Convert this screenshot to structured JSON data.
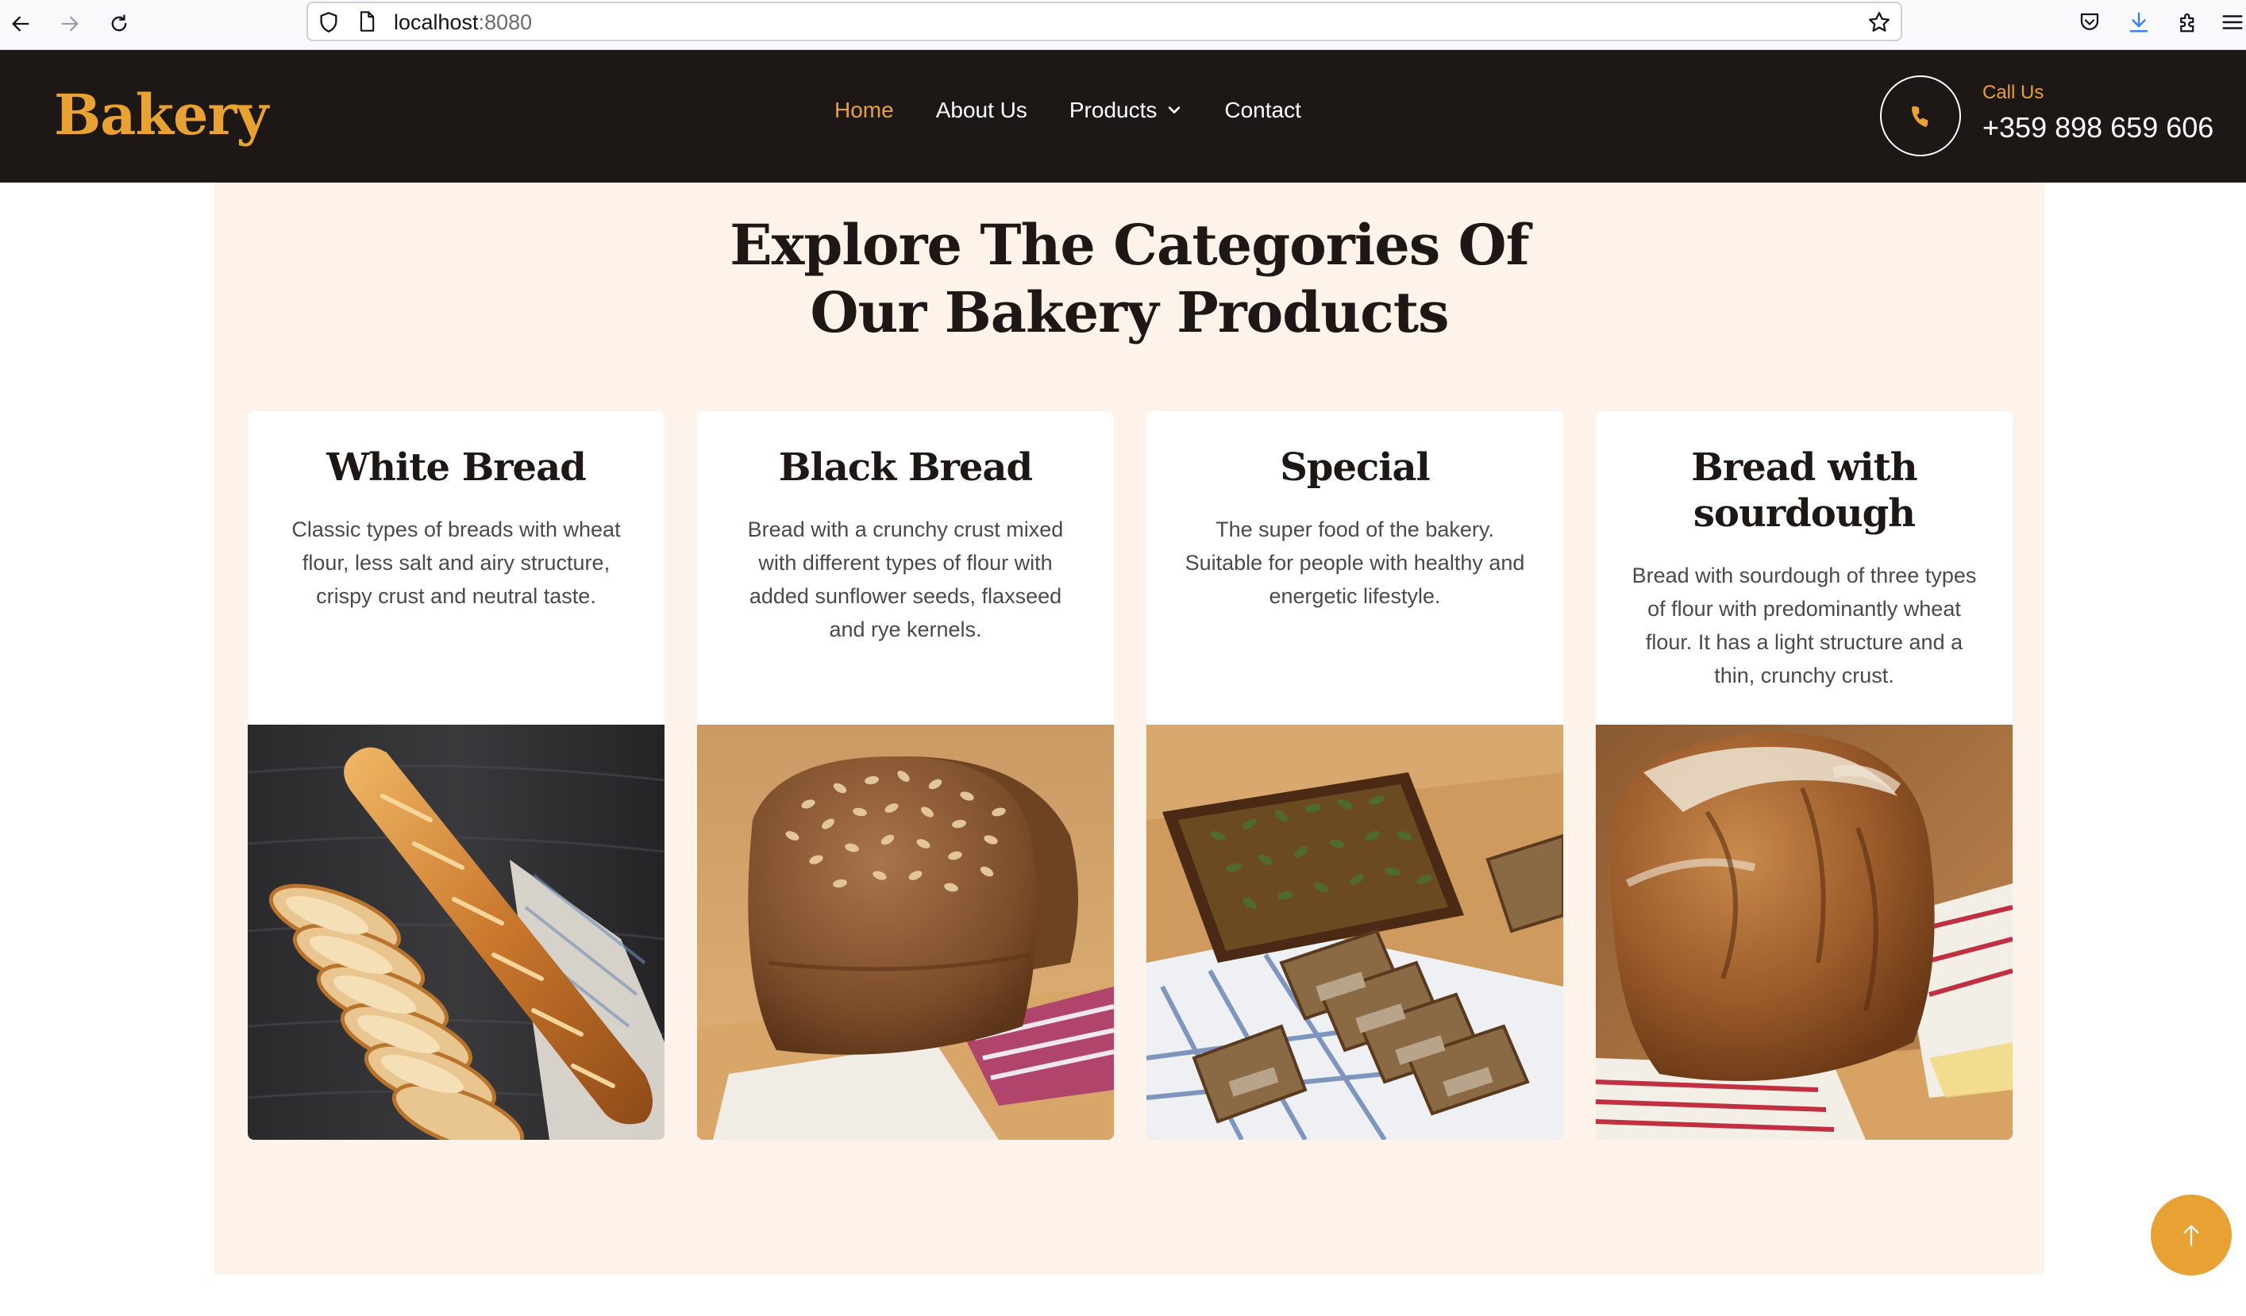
{
  "browser": {
    "url_host": "localhost",
    "url_port": ":8080"
  },
  "header": {
    "logo": "Bakery",
    "menu": [
      {
        "label": "Home",
        "active": true
      },
      {
        "label": "About Us",
        "active": false
      },
      {
        "label": "Products",
        "active": false,
        "has_dropdown": true
      },
      {
        "label": "Contact",
        "active": false
      }
    ],
    "call_label": "Call Us",
    "call_number": "+359 898 659 606"
  },
  "section": {
    "title_line1": "Explore The Categories Of",
    "title_line2": "Our Bakery Products",
    "cards": [
      {
        "title": "White Bread",
        "description": "Classic types of breads with wheat flour, less salt and airy structure, crispy crust and neutral taste.",
        "image": "baguette-photo"
      },
      {
        "title": "Black Bread",
        "description": "Bread with a crunchy crust mixed with different types of flour with added sunflower seeds, flaxseed and rye kernels.",
        "image": "seeded-loaf-photo"
      },
      {
        "title": "Special",
        "description": "The super food of the bakery. Suitable for people with healthy and energetic lifestyle.",
        "image": "pumpkin-seed-loaf-photo"
      },
      {
        "title": "Bread with sourdough",
        "description": "Bread with sourdough of three types of flour with predominantly wheat flour. It has a light structure and a thin, crunchy crust.",
        "image": "sourdough-loaf-photo"
      }
    ]
  },
  "colors": {
    "accent": "#e8a234",
    "header_bg": "#1d1816",
    "section_bg": "#fdf3eb"
  }
}
